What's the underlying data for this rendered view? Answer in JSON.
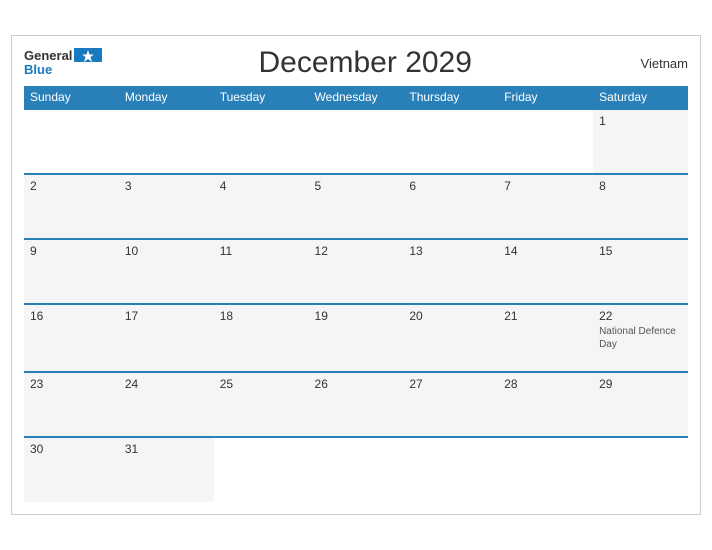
{
  "header": {
    "logo_general": "General",
    "logo_blue": "Blue",
    "month_title": "December 2029",
    "country": "Vietnam"
  },
  "weekdays": [
    "Sunday",
    "Monday",
    "Tuesday",
    "Wednesday",
    "Thursday",
    "Friday",
    "Saturday"
  ],
  "weeks": [
    [
      {
        "day": "",
        "empty": true
      },
      {
        "day": "",
        "empty": true
      },
      {
        "day": "",
        "empty": true
      },
      {
        "day": "",
        "empty": true
      },
      {
        "day": "",
        "empty": true
      },
      {
        "day": "",
        "empty": true
      },
      {
        "day": "1",
        "empty": false,
        "holiday": ""
      }
    ],
    [
      {
        "day": "2",
        "empty": false,
        "holiday": ""
      },
      {
        "day": "3",
        "empty": false,
        "holiday": ""
      },
      {
        "day": "4",
        "empty": false,
        "holiday": ""
      },
      {
        "day": "5",
        "empty": false,
        "holiday": ""
      },
      {
        "day": "6",
        "empty": false,
        "holiday": ""
      },
      {
        "day": "7",
        "empty": false,
        "holiday": ""
      },
      {
        "day": "8",
        "empty": false,
        "holiday": ""
      }
    ],
    [
      {
        "day": "9",
        "empty": false,
        "holiday": ""
      },
      {
        "day": "10",
        "empty": false,
        "holiday": ""
      },
      {
        "day": "11",
        "empty": false,
        "holiday": ""
      },
      {
        "day": "12",
        "empty": false,
        "holiday": ""
      },
      {
        "day": "13",
        "empty": false,
        "holiday": ""
      },
      {
        "day": "14",
        "empty": false,
        "holiday": ""
      },
      {
        "day": "15",
        "empty": false,
        "holiday": ""
      }
    ],
    [
      {
        "day": "16",
        "empty": false,
        "holiday": ""
      },
      {
        "day": "17",
        "empty": false,
        "holiday": ""
      },
      {
        "day": "18",
        "empty": false,
        "holiday": ""
      },
      {
        "day": "19",
        "empty": false,
        "holiday": ""
      },
      {
        "day": "20",
        "empty": false,
        "holiday": ""
      },
      {
        "day": "21",
        "empty": false,
        "holiday": ""
      },
      {
        "day": "22",
        "empty": false,
        "holiday": "National Defence Day"
      }
    ],
    [
      {
        "day": "23",
        "empty": false,
        "holiday": ""
      },
      {
        "day": "24",
        "empty": false,
        "holiday": ""
      },
      {
        "day": "25",
        "empty": false,
        "holiday": ""
      },
      {
        "day": "26",
        "empty": false,
        "holiday": ""
      },
      {
        "day": "27",
        "empty": false,
        "holiday": ""
      },
      {
        "day": "28",
        "empty": false,
        "holiday": ""
      },
      {
        "day": "29",
        "empty": false,
        "holiday": ""
      }
    ],
    [
      {
        "day": "30",
        "empty": false,
        "holiday": ""
      },
      {
        "day": "31",
        "empty": false,
        "holiday": ""
      },
      {
        "day": "",
        "empty": true
      },
      {
        "day": "",
        "empty": true
      },
      {
        "day": "",
        "empty": true
      },
      {
        "day": "",
        "empty": true
      },
      {
        "day": "",
        "empty": true
      }
    ]
  ]
}
